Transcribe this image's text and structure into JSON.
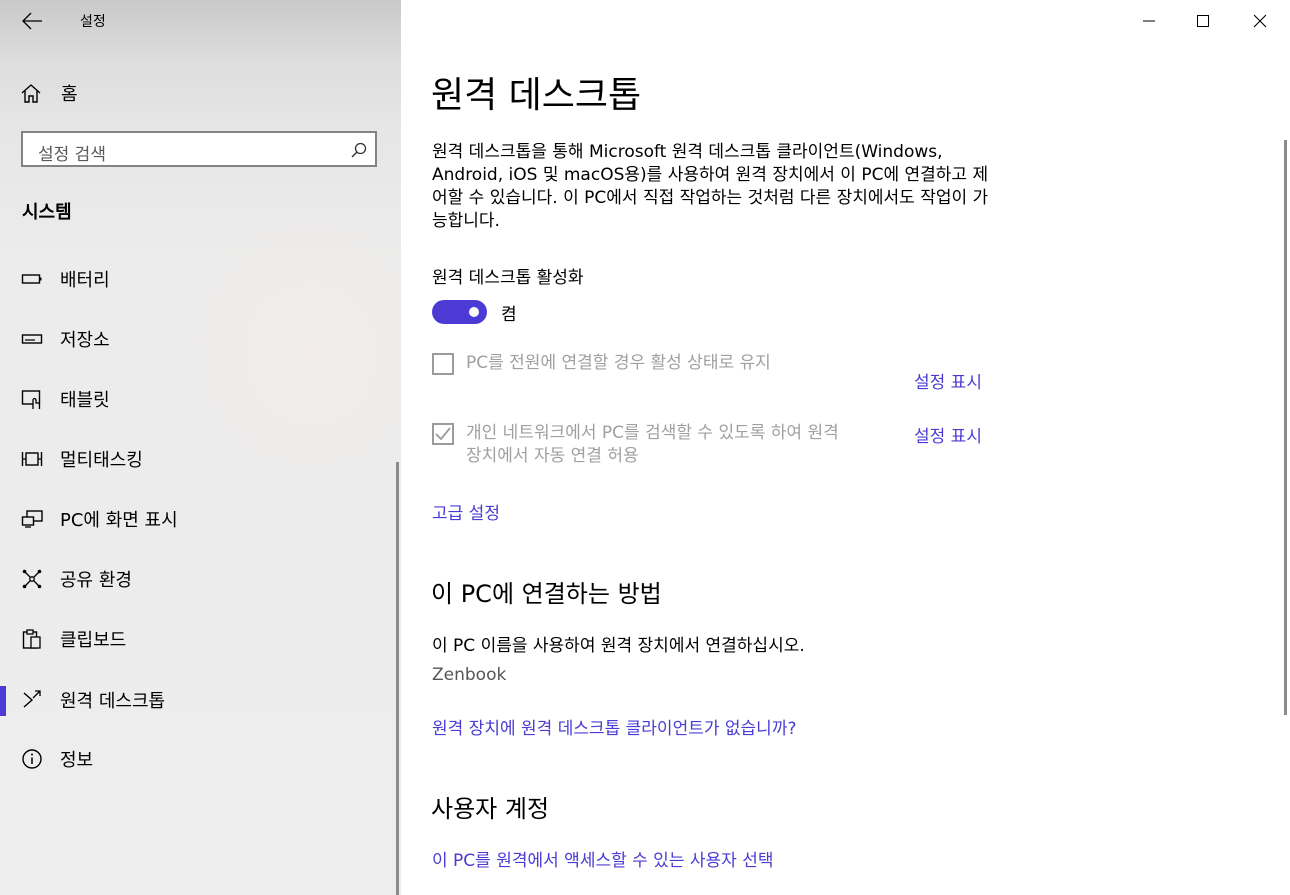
{
  "app": {
    "title": "설정"
  },
  "sidebar": {
    "home_label": "홈",
    "search_placeholder": "설정 검색",
    "section_title": "시스템",
    "items": [
      {
        "label": "배터리",
        "icon": "battery-icon"
      },
      {
        "label": "저장소",
        "icon": "storage-icon"
      },
      {
        "label": "태블릿",
        "icon": "tablet-icon"
      },
      {
        "label": "멀티태스킹",
        "icon": "multitasking-icon"
      },
      {
        "label": "PC에 화면 표시",
        "icon": "project-icon"
      },
      {
        "label": "공유 환경",
        "icon": "share-icon"
      },
      {
        "label": "클립보드",
        "icon": "clipboard-icon"
      },
      {
        "label": "원격 데스크톱",
        "icon": "remote-desktop-icon",
        "active": true
      },
      {
        "label": "정보",
        "icon": "info-icon"
      }
    ]
  },
  "main": {
    "title": "원격 데스크톱",
    "description": "원격 데스크톱을 통해 Microsoft 원격 데스크톱 클라이언트(Windows, Android, iOS 및 macOS용)를 사용하여 원격 장치에서 이 PC에 연결하고 제어할 수 있습니다. 이 PC에서 직접 작업하는 것처럼 다른 장치에서도 작업이 가능합니다.",
    "enable_label": "원격 데스크톱 활성화",
    "toggle_state": "켬",
    "toggle_on": true,
    "option1": {
      "label": "PC를 전원에 연결할 경우 활성 상태로 유지",
      "checked": false,
      "link": "설정 표시"
    },
    "option2": {
      "label_line1": "개인 네트워크에서 PC를 검색할 수 있도록 하여 원격",
      "label_line2": "장치에서 자동 연결 허용",
      "checked": true,
      "link": "설정 표시"
    },
    "advanced_link": "고급 설정",
    "connect_heading": "이 PC에 연결하는 방법",
    "connect_text": "이 PC 이름을 사용하여 원격 장치에서 연결하십시오.",
    "pc_name": "Zenbook",
    "client_link": "원격 장치에 원격 데스크톱 클라이언트가 없습니까?",
    "accounts_heading": "사용자 계정",
    "accounts_link": "이 PC를 원격에서 액세스할 수 있는 사용자 선택"
  },
  "colors": {
    "accent": "#4b3bd4"
  }
}
